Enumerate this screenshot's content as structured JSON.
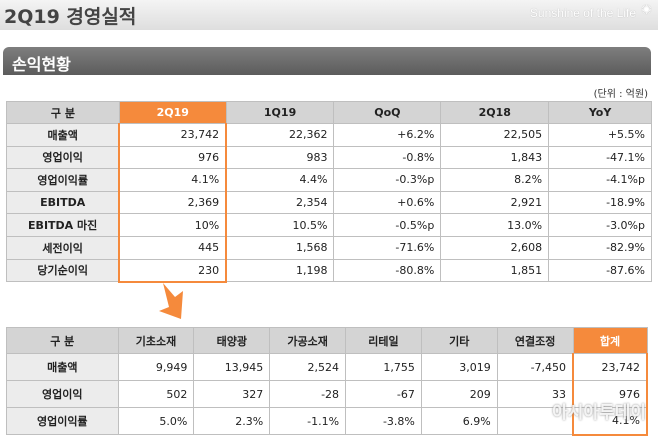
{
  "header": {
    "title": "2Q19 경영실적",
    "brand": "Sunshine of the Life"
  },
  "section": {
    "title": "손익현황"
  },
  "unit": "(단위 : 억원)",
  "table1": {
    "headers": [
      "구 분",
      "2Q19",
      "1Q19",
      "QoQ",
      "2Q18",
      "YoY"
    ],
    "rows": [
      [
        "매출액",
        "23,742",
        "22,362",
        "+6.2%",
        "22,505",
        "+5.5%"
      ],
      [
        "영업이익",
        "976",
        "983",
        "-0.8%",
        "1,843",
        "-47.1%"
      ],
      [
        "영업이익률",
        "4.1%",
        "4.4%",
        "-0.3%p",
        "8.2%",
        "-4.1%p"
      ],
      [
        "EBITDA",
        "2,369",
        "2,354",
        "+0.6%",
        "2,921",
        "-18.9%"
      ],
      [
        "EBITDA 마진",
        "10%",
        "10.5%",
        "-0.5%p",
        "13.0%",
        "-3.0%p"
      ],
      [
        "세전이익",
        "445",
        "1,568",
        "-71.6%",
        "2,608",
        "-82.9%"
      ],
      [
        "당기순이익",
        "230",
        "1,198",
        "-80.8%",
        "1,851",
        "-87.6%"
      ]
    ]
  },
  "table2": {
    "headers": [
      "구 분",
      "기초소재",
      "태양광",
      "가공소재",
      "리테일",
      "기타",
      "연결조정",
      "합계"
    ],
    "rows": [
      [
        "매출액",
        "9,949",
        "13,945",
        "2,524",
        "1,755",
        "3,019",
        "-7,450",
        "23,742"
      ],
      [
        "영업이익",
        "502",
        "327",
        "-28",
        "-67",
        "209",
        "33",
        "976"
      ],
      [
        "영업이익률",
        "5.0%",
        "2.3%",
        "-1.1%",
        "-3.8%",
        "6.9%",
        "",
        "4.1%"
      ]
    ]
  },
  "watermark": "아시아투데이",
  "colors": {
    "accent": "#f58a3c",
    "header_bg": "#d4d4d4",
    "section_bg": "#6b6b6b"
  }
}
